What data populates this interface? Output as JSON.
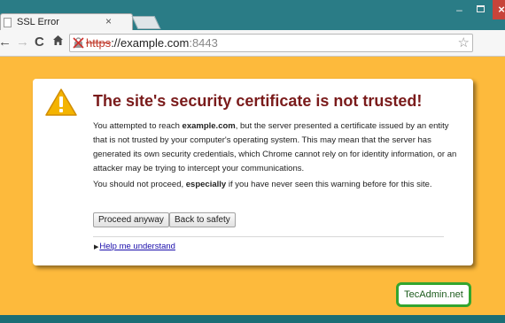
{
  "browser": {
    "tab": {
      "title": "SSL Error",
      "close": "×",
      "favicon_icon": "page-icon"
    },
    "window_controls": {
      "minimize": "–",
      "close": "×"
    },
    "nav_icons": {
      "back": "arrow-left-icon",
      "forward": "arrow-right-icon",
      "reload": "reload-icon",
      "home": "home-icon"
    },
    "omnibox": {
      "ssl_status_icon": "broken-lock-icon",
      "url_scheme": "https",
      "url_rest": "://example.com",
      "url_port": ":8443",
      "bookmark_icon": "star-icon"
    },
    "extension_icon": "extension-icon",
    "menu_icon": "hamburger-menu-icon"
  },
  "interstitial": {
    "icon": "warning-triangle-icon",
    "headline": "The site's security certificate is not trusted!",
    "para1_prefix": "You attempted to reach ",
    "para1_host": "example.com",
    "para1_suffix": ", but the server presented a certificate issued by an entity that is not trusted by your computer's operating system. This may mean that the server has generated its own security credentials, which Chrome cannot rely on for identity information, or an attacker may be trying to intercept your communications.",
    "para2_prefix": "You should not proceed, ",
    "para2_bold": "especially",
    "para2_suffix": " if you have never seen this warning before for this site.",
    "proceed_button": "Proceed anyway",
    "back_button": "Back to safety",
    "help_link": "Help me understand"
  },
  "watermark": {
    "text": "TecAdmin.net"
  },
  "colors": {
    "page_background": "#fdba3c",
    "headline": "#7a1b1b",
    "link": "#1a0dab",
    "watermark_border": "#34a52f",
    "titlebar": "#2a7c86"
  }
}
